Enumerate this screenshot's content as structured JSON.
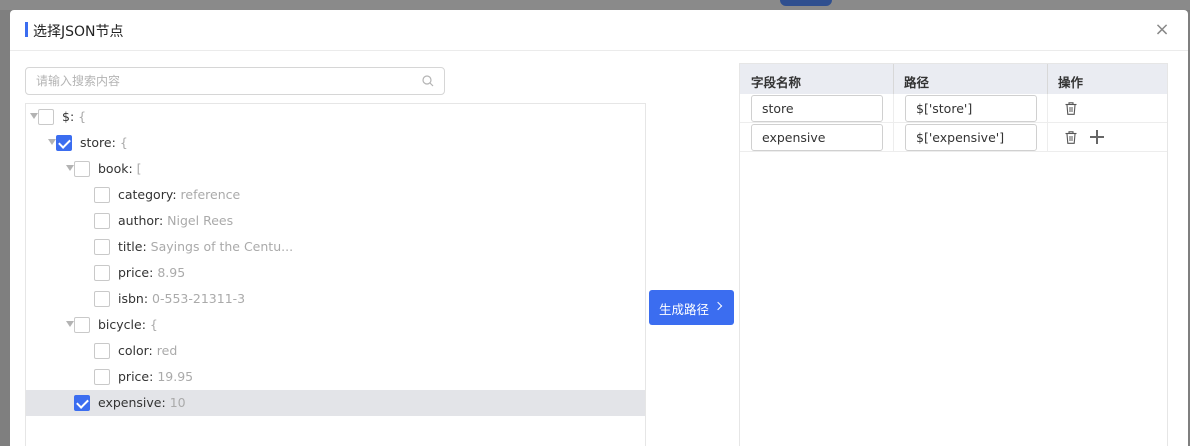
{
  "dialog": {
    "title": "选择JSON节点",
    "close_glyph": "×"
  },
  "search": {
    "placeholder": "请输入搜索内容",
    "value": ""
  },
  "tree": [
    {
      "depth": 0,
      "arrow": true,
      "checked": false,
      "selected": false,
      "key": "$:",
      "value": "{"
    },
    {
      "depth": 1,
      "arrow": true,
      "checked": true,
      "selected": false,
      "key": "store:",
      "value": "{"
    },
    {
      "depth": 2,
      "arrow": true,
      "checked": false,
      "selected": false,
      "key": "book:",
      "value": "["
    },
    {
      "depth": 3,
      "arrow": false,
      "checked": false,
      "selected": false,
      "key": "category:",
      "value": "reference"
    },
    {
      "depth": 3,
      "arrow": false,
      "checked": false,
      "selected": false,
      "key": "author:",
      "value": "Nigel Rees"
    },
    {
      "depth": 3,
      "arrow": false,
      "checked": false,
      "selected": false,
      "key": "title:",
      "value": "Sayings of the Centu..."
    },
    {
      "depth": 3,
      "arrow": false,
      "checked": false,
      "selected": false,
      "key": "price:",
      "value": "8.95"
    },
    {
      "depth": 3,
      "arrow": false,
      "checked": false,
      "selected": false,
      "key": "isbn:",
      "value": "0-553-21311-3"
    },
    {
      "depth": 2,
      "arrow": true,
      "checked": false,
      "selected": false,
      "key": "bicycle:",
      "value": "{"
    },
    {
      "depth": 3,
      "arrow": false,
      "checked": false,
      "selected": false,
      "key": "color:",
      "value": "red"
    },
    {
      "depth": 3,
      "arrow": false,
      "checked": false,
      "selected": false,
      "key": "price:",
      "value": "19.95"
    },
    {
      "depth": 1,
      "arrow": false,
      "checked": true,
      "selected": true,
      "key": "expensive:",
      "value": "10"
    }
  ],
  "generate_button": {
    "label": "生成路径"
  },
  "table": {
    "headers": [
      "字段名称",
      "路径",
      "操作"
    ],
    "rows": [
      {
        "name": "store",
        "path": "$['store']",
        "show_add": false
      },
      {
        "name": "expensive",
        "path": "$['expensive']",
        "show_add": true
      }
    ]
  },
  "colors": {
    "accent": "#3b6df0",
    "selected_row": "#e3e4e8",
    "table_header": "#eaecf2"
  },
  "icons": [
    "close-icon",
    "search-icon",
    "caret-down-icon",
    "checkbox-icon",
    "chevron-right-icon",
    "trash-icon",
    "plus-icon"
  ]
}
